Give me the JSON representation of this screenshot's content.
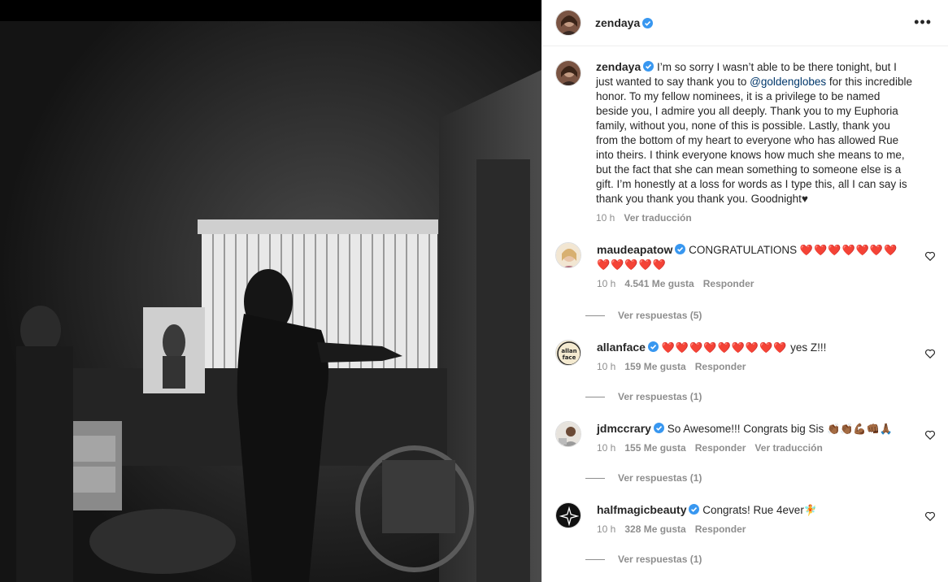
{
  "post": {
    "author": "zendaya",
    "more_icon": "more-horizontal-icon",
    "caption": {
      "user": "zendaya",
      "part1": "I’m so sorry I wasn’t able to be there tonight, but I just wanted to say thank you to ",
      "mention": "@goldenglobes",
      "part2": " for this incredible honor. To my fellow nominees, it is a privilege to be named beside you, I admire you all deeply. Thank you to my Euphoria family, without you, none of this is possible. Lastly, thank you from the bottom of my heart to everyone who has allowed Rue into theirs. I think everyone knows how much she means to me, but the fact that she can mean something to someone else is a gift. I’m honestly at a loss for words as I type this, all I can say is thank you thank you thank you. Goodnight♥",
      "time": "10 h",
      "translate": "Ver traducción"
    }
  },
  "comments": [
    {
      "user": "maudeapatow",
      "text": "CONGRATULATIONS ",
      "emoji": "❤️❤️❤️❤️❤️❤️❤️❤️❤️❤️❤️❤️",
      "time": "10 h",
      "likes": "4.541 Me gusta",
      "reply": "Responder",
      "view_replies": "Ver respuestas (5)"
    },
    {
      "user": "allanface",
      "text": "",
      "emoji": "❤️❤️❤️❤️❤️❤️❤️❤️❤️",
      "suffix": " yes Z!!!",
      "time": "10 h",
      "likes": "159 Me gusta",
      "reply": "Responder",
      "view_replies": "Ver respuestas (1)"
    },
    {
      "user": "jdmccrary",
      "text": "So Awesome!!! Congrats big Sis ",
      "emoji": "👏🏾👏🏾💪🏾👊🏾🙏🏾",
      "time": "10 h",
      "likes": "155 Me gusta",
      "reply": "Responder",
      "translate": "Ver traducción",
      "view_replies": "Ver respuestas (1)"
    },
    {
      "user": "halfmagicbeauty",
      "text": "Congrats! Rue 4ever",
      "emoji": "🧚",
      "time": "10 h",
      "likes": "328 Me gusta",
      "reply": "Responder",
      "view_replies": "Ver respuestas (1)"
    }
  ],
  "avatar_texts": {
    "allanface": "allan face"
  },
  "colors": {
    "verified": "#3897f0",
    "link": "#00376b",
    "muted": "#8e8e8e",
    "text": "#262626"
  }
}
